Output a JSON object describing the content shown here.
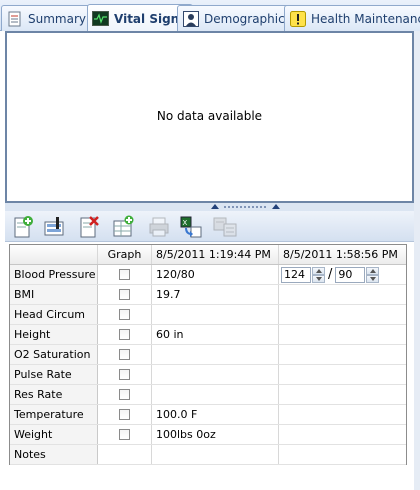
{
  "tabs": [
    {
      "label": "Summary",
      "icon": "checklist-icon",
      "active": false
    },
    {
      "label": "Vital Signs",
      "icon": "heart-monitor-icon",
      "active": true
    },
    {
      "label": "Demographics",
      "icon": "person-icon",
      "active": false
    },
    {
      "label": "Health Maintenance",
      "icon": "alert-icon",
      "active": false
    }
  ],
  "graph": {
    "empty_message": "No data available"
  },
  "toolbar": {
    "buttons": [
      {
        "icon": "add-record-icon",
        "enabled": true
      },
      {
        "icon": "edit-record-icon",
        "enabled": true
      },
      {
        "icon": "delete-record-icon",
        "enabled": true
      },
      {
        "icon": "add-column-icon",
        "enabled": true
      },
      {
        "icon": "print-icon",
        "enabled": false
      },
      {
        "icon": "export-icon",
        "enabled": true
      },
      {
        "icon": "transfer-icon",
        "enabled": false
      }
    ]
  },
  "grid": {
    "columns": {
      "name": "",
      "graph": "Graph",
      "date1": "8/5/2011 1:19:44 PM",
      "date2": "8/5/2011 1:58:56 PM"
    },
    "rows": [
      {
        "name": "Blood Pressure",
        "has_graph": true,
        "v1": "120/80",
        "v2_edit": true
      },
      {
        "name": "BMI",
        "has_graph": true,
        "v1": "19.7",
        "v2": ""
      },
      {
        "name": "Head Circum",
        "has_graph": true,
        "v1": "",
        "v2": ""
      },
      {
        "name": "Height",
        "has_graph": true,
        "v1": "60 in",
        "v2": ""
      },
      {
        "name": "O2 Saturation",
        "has_graph": true,
        "v1": "",
        "v2": ""
      },
      {
        "name": "Pulse Rate",
        "has_graph": true,
        "v1": "",
        "v2": ""
      },
      {
        "name": "Res Rate",
        "has_graph": true,
        "v1": "",
        "v2": ""
      },
      {
        "name": "Temperature",
        "has_graph": true,
        "v1": "100.0 F",
        "v2": ""
      },
      {
        "name": "Weight",
        "has_graph": true,
        "v1": "100lbs 0oz",
        "v2": ""
      },
      {
        "name": "Notes",
        "has_graph": false,
        "v1": "",
        "v2": ""
      }
    ],
    "bp_edit": {
      "systolic": "124",
      "separator": "/",
      "diastolic": "90"
    }
  },
  "colors": {
    "accent": "#1f3f6e",
    "tab_border": "#8fa9cc",
    "frame": "#6d85a6"
  }
}
